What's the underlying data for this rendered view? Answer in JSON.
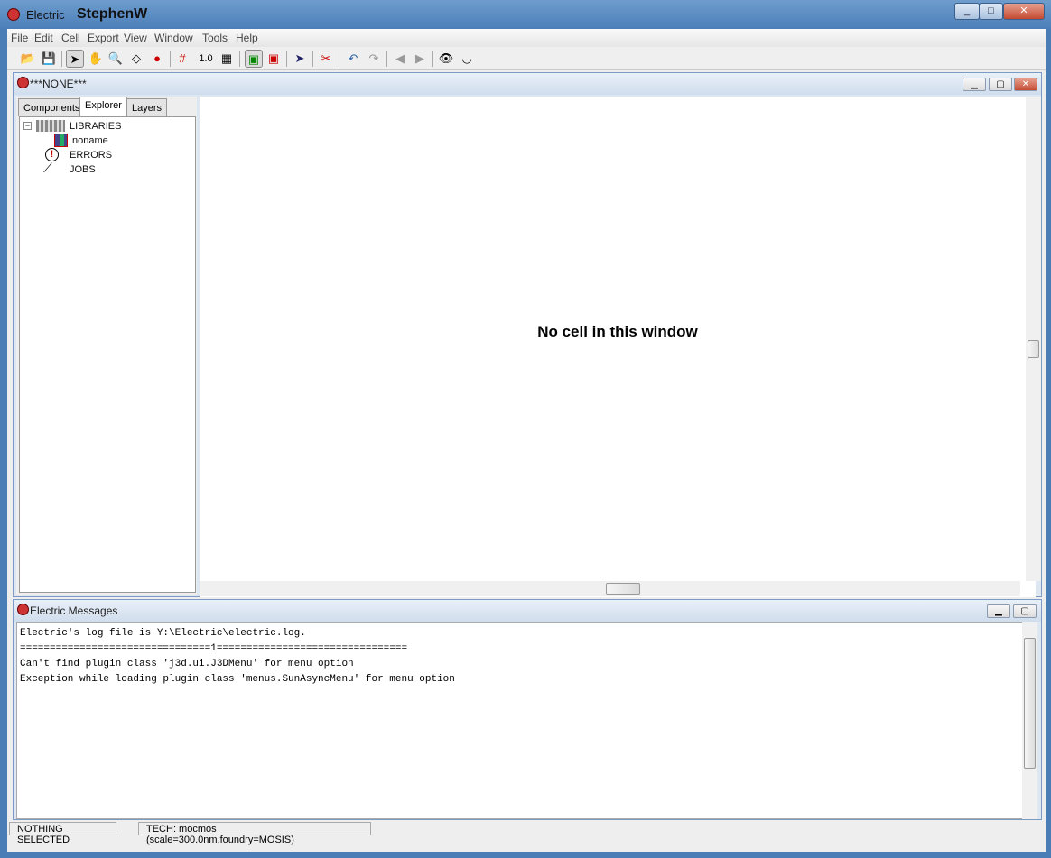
{
  "window": {
    "app_name": "Electric",
    "user": "StephenW",
    "controls": [
      "_",
      "□",
      "✕"
    ]
  },
  "menubar": [
    "File",
    "Edit",
    "Cell",
    "Export",
    "View",
    "Window",
    "Tools",
    "Help"
  ],
  "toolbar": {
    "scale_label": "1.0"
  },
  "edit_window": {
    "title": "***NONE***",
    "tabs": [
      "Components",
      "Explorer",
      "Layers"
    ],
    "active_tab": "Explorer",
    "tree": {
      "libraries": "LIBRARIES",
      "library": "noname",
      "errors": "ERRORS",
      "jobs": "JOBS"
    },
    "empty_message": "No cell in this window"
  },
  "messages": {
    "title": "Electric Messages",
    "lines": [
      "Electric's log file is Y:\\Electric\\electric.log.",
      "================================1================================",
      "Can't find plugin class 'j3d.ui.J3DMenu' for menu option",
      "Exception while loading plugin class 'menus.SunAsyncMenu' for menu option"
    ]
  },
  "status": {
    "selection": "NOTHING SELECTED",
    "tech": "TECH: mocmos (scale=300.0nm,foundry=MOSIS)"
  }
}
